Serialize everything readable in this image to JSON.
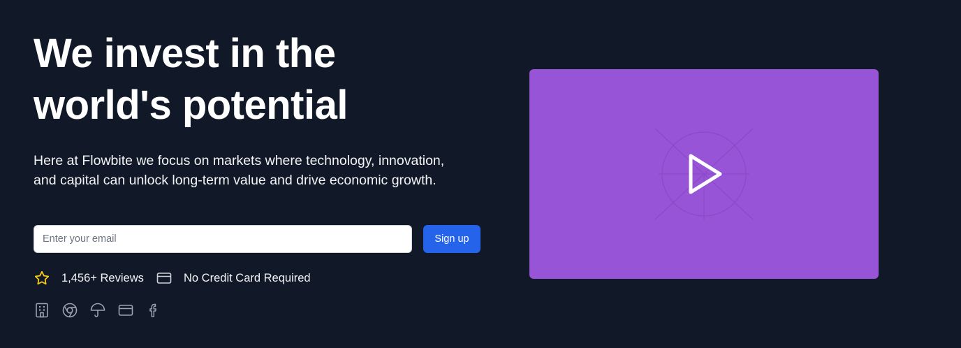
{
  "hero": {
    "headline": "We invest in the world's potential",
    "lede": "Here at Flowbite we focus on markets where technology, innovation, and capital can unlock long-term value and drive economic growth.",
    "signup": {
      "email_placeholder": "Enter your email",
      "button_label": "Sign up"
    },
    "features": [
      {
        "icon": "star-icon",
        "label": "1,456+ Reviews"
      },
      {
        "icon": "credit-card-icon",
        "label": "No Credit Card Required"
      }
    ],
    "partner_icons": [
      "building-icon",
      "chrome-icon",
      "umbrella-icon",
      "credit-card-icon",
      "facebook-icon"
    ]
  },
  "video": {
    "background_color": "#9754d6",
    "play_icon": "play-icon"
  },
  "colors": {
    "page_background": "#111827",
    "primary_button": "#2563eb",
    "star": "#facc15"
  }
}
